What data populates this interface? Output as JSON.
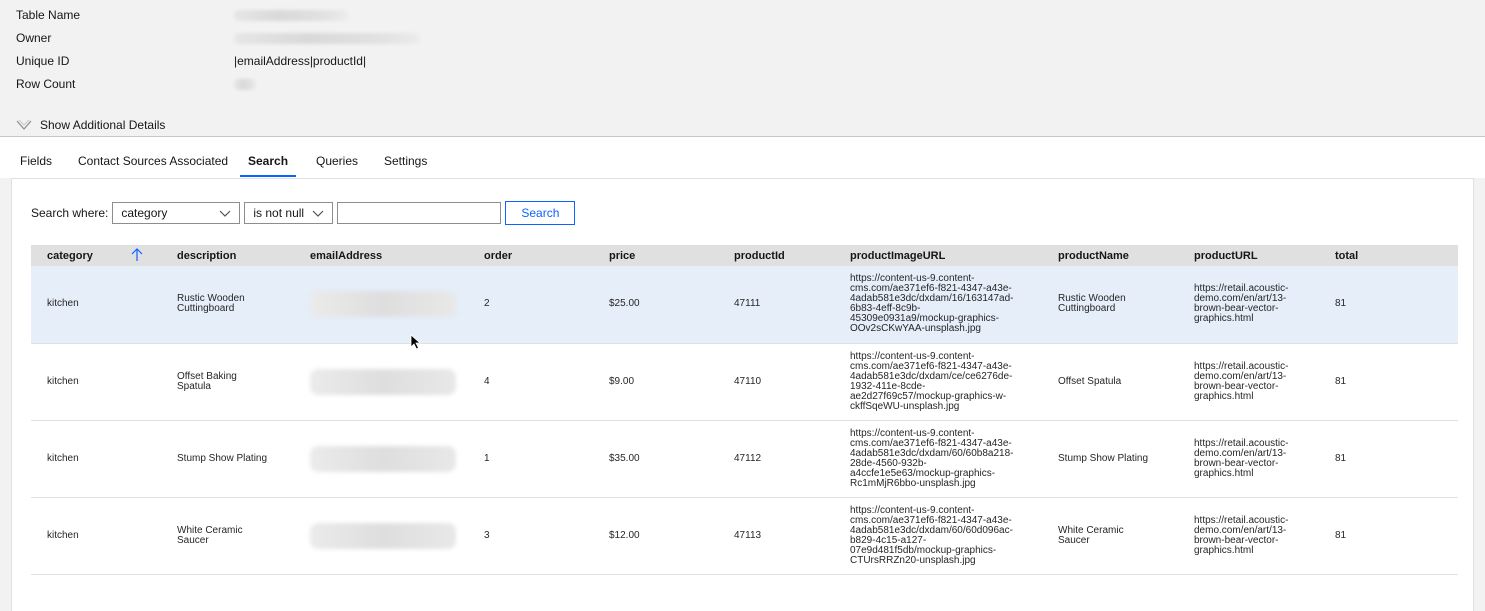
{
  "details": {
    "table_name_label": "Table Name",
    "owner_label": "Owner",
    "unique_id_label": "Unique ID",
    "unique_id_value": "|emailAddress|productId|",
    "row_count_label": "Row Count",
    "show_additional": "Show Additional Details"
  },
  "tabs": [
    {
      "label": "Fields"
    },
    {
      "label": "Contact Sources Associated"
    },
    {
      "label": "Search"
    },
    {
      "label": "Queries"
    },
    {
      "label": "Settings"
    }
  ],
  "search": {
    "label": "Search where:",
    "field_value": "category",
    "operator_value": "is not null",
    "input_value": "",
    "button_label": "Search"
  },
  "table": {
    "columns": [
      "category",
      "description",
      "emailAddress",
      "order",
      "price",
      "productId",
      "productImageURL",
      "productName",
      "productURL",
      "total"
    ],
    "rows": [
      {
        "category": "kitchen",
        "description": [
          "Rustic Wooden",
          "Cuttingboard"
        ],
        "order": "2",
        "price": "$25.00",
        "productId": "47111",
        "productImageURL": [
          "https://content-us-9.content-",
          "cms.com/ae371ef6-f821-4347-a43e-",
          "4adab581e3dc/dxdam/16/163147ad-",
          "6b83-4eff-8c9b-",
          "45309e0931a9/mockup-graphics-",
          "OOv2sCKwYAA-unsplash.jpg"
        ],
        "productName": [
          "Rustic Wooden",
          "Cuttingboard"
        ],
        "productURL": [
          "https://retail.acoustic-",
          "demo.com/en/art/13-",
          "brown-bear-vector-",
          "graphics.html"
        ],
        "total": "81"
      },
      {
        "category": "kitchen",
        "description": [
          "Offset Baking",
          "Spatula"
        ],
        "order": "4",
        "price": "$9.00",
        "productId": "47110",
        "productImageURL": [
          "https://content-us-9.content-",
          "cms.com/ae371ef6-f821-4347-a43e-",
          "4adab581e3dc/dxdam/ce/ce6276de-",
          "1932-411e-8cde-",
          "ae2d27f69c57/mockup-graphics-w-",
          "ckffSqeWU-unsplash.jpg"
        ],
        "productName": [
          "Offset Spatula"
        ],
        "productURL": [
          "https://retail.acoustic-",
          "demo.com/en/art/13-",
          "brown-bear-vector-",
          "graphics.html"
        ],
        "total": "81"
      },
      {
        "category": "kitchen",
        "description": [
          "Stump Show Plating"
        ],
        "order": "1",
        "price": "$35.00",
        "productId": "47112",
        "productImageURL": [
          "https://content-us-9.content-",
          "cms.com/ae371ef6-f821-4347-a43e-",
          "4adab581e3dc/dxdam/60/60b8a218-",
          "28de-4560-932b-",
          "a4ccfe1e5e63/mockup-graphics-",
          "Rc1mMjR6bbo-unsplash.jpg"
        ],
        "productName": [
          "Stump Show Plating"
        ],
        "productURL": [
          "https://retail.acoustic-",
          "demo.com/en/art/13-",
          "brown-bear-vector-",
          "graphics.html"
        ],
        "total": "81"
      },
      {
        "category": "kitchen",
        "description": [
          "White Ceramic",
          "Saucer"
        ],
        "order": "3",
        "price": "$12.00",
        "productId": "47113",
        "productImageURL": [
          "https://content-us-9.content-",
          "cms.com/ae371ef6-f821-4347-a43e-",
          "4adab581e3dc/dxdam/60/60d096ac-",
          "b829-4c15-a127-",
          "07e9d481f5db/mockup-graphics-",
          "CTUrsRRZn20-unsplash.jpg"
        ],
        "productName": [
          "White Ceramic",
          "Saucer"
        ],
        "productURL": [
          "https://retail.acoustic-",
          "demo.com/en/art/13-",
          "brown-bear-vector-",
          "graphics.html"
        ],
        "total": "81"
      }
    ]
  },
  "colors": {
    "accent": "#0f62fe",
    "row_highlight": "#e5eef9",
    "header_bg": "#e0e0e0",
    "page_bg": "#f2f2f2"
  },
  "icons": {
    "show_details": "chevron-down-icon",
    "sort": "arrow-up-icon",
    "select": "chevron-down-icon"
  }
}
